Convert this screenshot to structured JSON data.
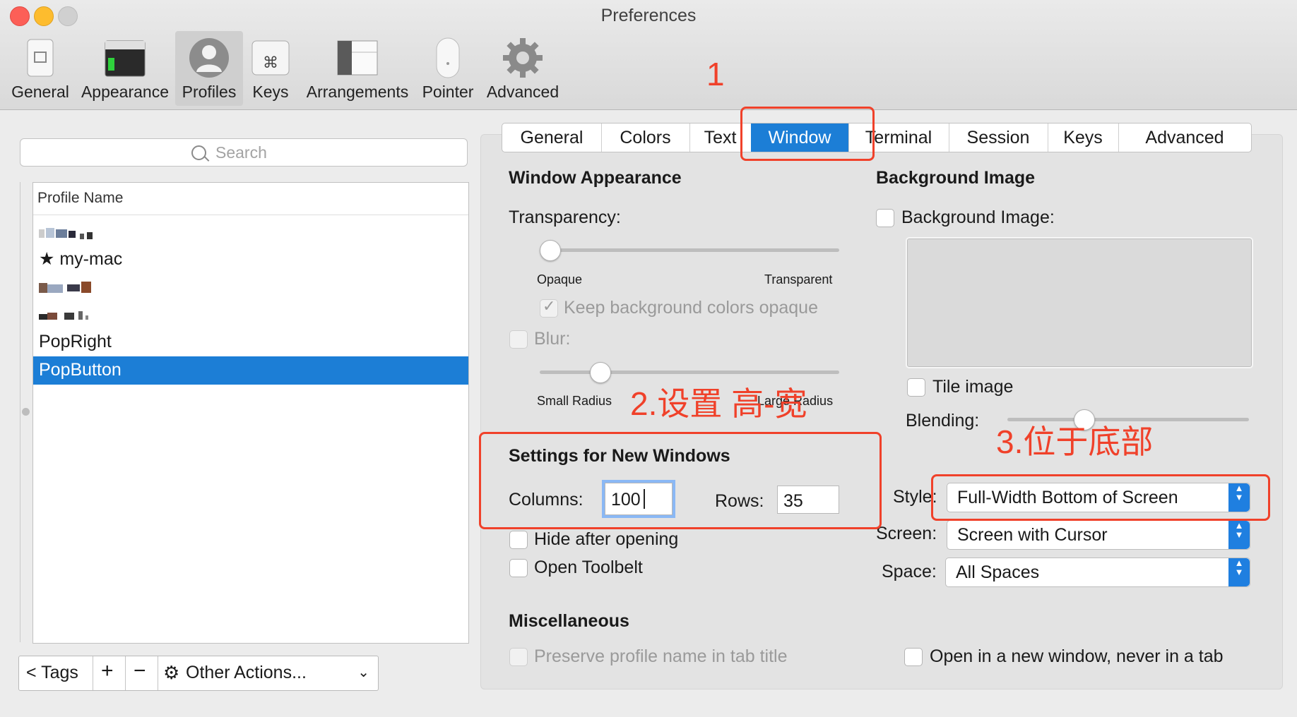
{
  "window": {
    "title": "Preferences"
  },
  "toolbar": {
    "items": [
      {
        "label": "General"
      },
      {
        "label": "Appearance"
      },
      {
        "label": "Profiles"
      },
      {
        "label": "Keys"
      },
      {
        "label": "Arrangements"
      },
      {
        "label": "Pointer"
      },
      {
        "label": "Advanced"
      }
    ],
    "selected": "Profiles"
  },
  "sidebar": {
    "search_placeholder": "Search",
    "column_header": "Profile Name",
    "profiles": [
      {
        "label": ""
      },
      {
        "label": "★ my-mac"
      },
      {
        "label": ""
      },
      {
        "label": ""
      },
      {
        "label": "PopRight"
      },
      {
        "label": "PopButton"
      }
    ],
    "selected": "PopButton",
    "bottom": {
      "tags": "< Tags",
      "add": "+",
      "remove": "−",
      "other_actions": "Other Actions..."
    }
  },
  "tabs": {
    "items": [
      "General",
      "Colors",
      "Text",
      "Window",
      "Terminal",
      "Session",
      "Keys",
      "Advanced"
    ],
    "selected": "Window"
  },
  "window_appearance": {
    "heading": "Window Appearance",
    "transparency_label": "Transparency:",
    "transparency_value": 0.0,
    "opaque": "Opaque",
    "transparent": "Transparent",
    "keep_bg_opaque": "Keep background colors opaque",
    "keep_bg_opaque_checked": true,
    "blur": "Blur:",
    "blur_checked": false,
    "blur_radius_value": 0.18,
    "small_radius": "Small Radius",
    "large_radius": "Large Radius"
  },
  "new_windows": {
    "heading": "Settings for New Windows",
    "columns_label": "Columns:",
    "columns_value": "100",
    "rows_label": "Rows:",
    "rows_value": "35",
    "hide_after_opening": "Hide after opening",
    "open_toolbelt": "Open Toolbelt"
  },
  "background_image": {
    "heading": "Background Image",
    "checkbox": "Background Image:",
    "tile": "Tile image",
    "blending_label": "Blending:",
    "blending_value": 0.3
  },
  "placement": {
    "style_label": "Style:",
    "style_value": "Full-Width Bottom of Screen",
    "screen_label": "Screen:",
    "screen_value": "Screen with Cursor",
    "space_label": "Space:",
    "space_value": "All Spaces"
  },
  "misc": {
    "heading": "Miscellaneous",
    "preserve_name": "Preserve profile name in tab title",
    "open_new_window": "Open in a new window, never in a tab"
  },
  "annotations": {
    "step1": "1",
    "step2": "2.设置 高-宽",
    "step3": "3.位于底部",
    "color": "#f0412a"
  },
  "colors": {
    "accent": "#1c7ed6",
    "close": "#fc5f57",
    "minimize": "#fdbc2e",
    "zoom": "#cfcfcf"
  }
}
